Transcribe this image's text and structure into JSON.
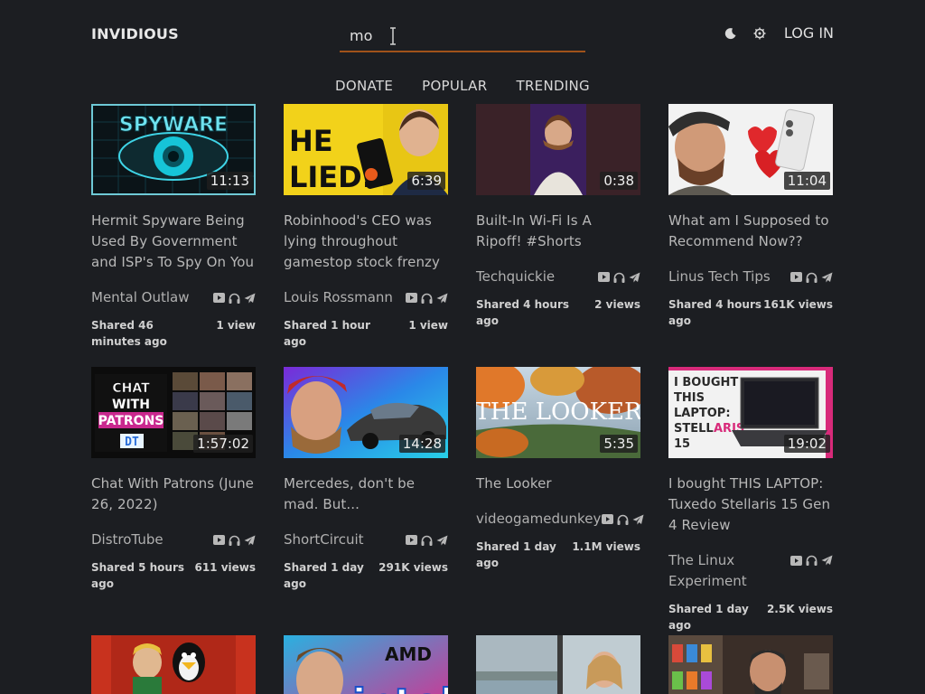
{
  "header": {
    "brand": "INVIDIOUS",
    "search_value": "mo",
    "login_label": "LOG IN",
    "theme_icon": "moon-icon",
    "prefs_icon": "gear-icon"
  },
  "nav": [
    "DONATE",
    "POPULAR",
    "TRENDING"
  ],
  "colors": {
    "background": "#1c1e22",
    "search_underline": "#a0521a",
    "selected_outline": "#6ec9d6"
  },
  "videos": [
    {
      "title": "Hermit Spyware Being Used By Government and ISP's To Spy On You",
      "duration": "11:13",
      "channel": "Mental Outlaw",
      "shared": "Shared 46 minutes ago",
      "views": "1 view",
      "thumb_text": "SPYWARE"
    },
    {
      "title": "Robinhood's CEO was lying throughout gamestop stock frenzy",
      "duration": "6:39",
      "channel": "Louis Rossmann",
      "shared": "Shared 1 hour ago",
      "views": "1 view",
      "thumb_text": "HE LIED."
    },
    {
      "title": "Built-In Wi-Fi Is A Ripoff! #Shorts",
      "duration": "0:38",
      "channel": "Techquickie",
      "shared": "Shared 4 hours ago",
      "views": "2 views",
      "thumb_text": ""
    },
    {
      "title": "What am I Supposed to Recommend Now??",
      "duration": "11:04",
      "channel": "Linus Tech Tips",
      "shared": "Shared 4 hours ago",
      "views": "161K views",
      "thumb_text": ""
    },
    {
      "title": "Chat With Patrons (June 26, 2022)",
      "duration": "1:57:02",
      "channel": "DistroTube",
      "shared": "Shared 5 hours ago",
      "views": "611 views",
      "thumb_text": "CHAT WITH PATRONS"
    },
    {
      "title": "Mercedes, don't be mad. But...",
      "duration": "14:28",
      "channel": "ShortCircuit",
      "shared": "Shared 1 day ago",
      "views": "291K views",
      "thumb_text": ""
    },
    {
      "title": "The Looker",
      "duration": "5:35",
      "channel": "videogamedunkey",
      "shared": "Shared 1 day ago",
      "views": "1.1M views",
      "thumb_text": "THE LOOKER"
    },
    {
      "title": "I bought THIS LAPTOP: Tuxedo Stellaris 15 Gen 4 Review",
      "duration": "19:02",
      "channel": "The Linux Experiment",
      "shared": "Shared 1 day ago",
      "views": "2.5K views",
      "thumb_text": "I BOUGHT THIS LAPTOP: STELLARIS 15"
    }
  ],
  "row3_thumbs": [
    "linux-tux-thumbnail",
    "amd-intel-thumbnail",
    "lake-thumbnail",
    "shelf-thumbnail"
  ],
  "card_icons": [
    "youtube-icon",
    "headphones-icon",
    "plane-icon"
  ]
}
